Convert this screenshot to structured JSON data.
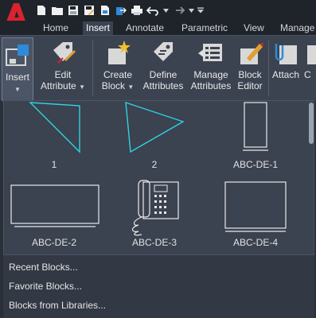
{
  "app": {
    "logo_letter": "A"
  },
  "quick_access": {
    "icons": [
      "new-file-icon",
      "open-folder-icon",
      "save-icon",
      "save-as-icon",
      "publish-icon",
      "import-icon",
      "print-icon",
      "undo-icon",
      "redo-icon",
      "customize-icon"
    ]
  },
  "tabs": [
    {
      "label": "Home"
    },
    {
      "label": "Insert"
    },
    {
      "label": "Annotate"
    },
    {
      "label": "Parametric"
    },
    {
      "label": "View"
    },
    {
      "label": "Manage"
    }
  ],
  "ribbon": {
    "insert": "Insert",
    "edit_attribute_1": "Edit",
    "edit_attribute_2": "Attribute",
    "create_block_1": "Create",
    "create_block_2": "Block",
    "define_attributes_1": "Define",
    "define_attributes_2": "Attributes",
    "manage_attributes_1": "Manage",
    "manage_attributes_2": "Attributes",
    "block_editor_1": "Block",
    "block_editor_2": "Editor",
    "attach": "Attach",
    "clip_partial": "C"
  },
  "gallery": {
    "blocks": [
      {
        "name": "1"
      },
      {
        "name": "2"
      },
      {
        "name": "ABC-DE-1"
      },
      {
        "name": "ABC-DE-2"
      },
      {
        "name": "ABC-DE-3"
      },
      {
        "name": "ABC-DE-4"
      }
    ]
  },
  "menu": {
    "recent": "Recent Blocks...",
    "favorite": "Favorite Blocks...",
    "libraries": "Blocks from Libraries..."
  },
  "colors": {
    "logo_red": "#d9232e",
    "triangle_cyan": "#2fd3e0",
    "ribbon_bg": "#3c4350"
  }
}
